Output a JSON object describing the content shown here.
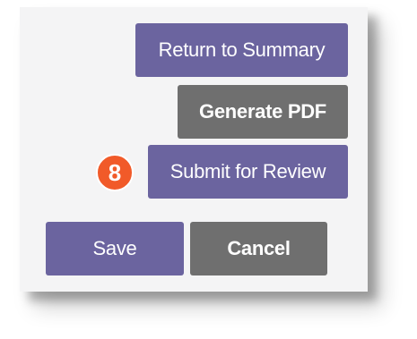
{
  "buttons": {
    "return_to_summary": "Return to Summary",
    "generate_pdf": "Generate PDF",
    "submit_for_review": "Submit for Review",
    "save": "Save",
    "cancel": "Cancel"
  },
  "callout": {
    "step_number": "8"
  },
  "colors": {
    "primary_button": "#6b649f",
    "secondary_button": "#6f6f6f",
    "callout_badge": "#f15a29",
    "panel_background": "#f4f4f5"
  }
}
